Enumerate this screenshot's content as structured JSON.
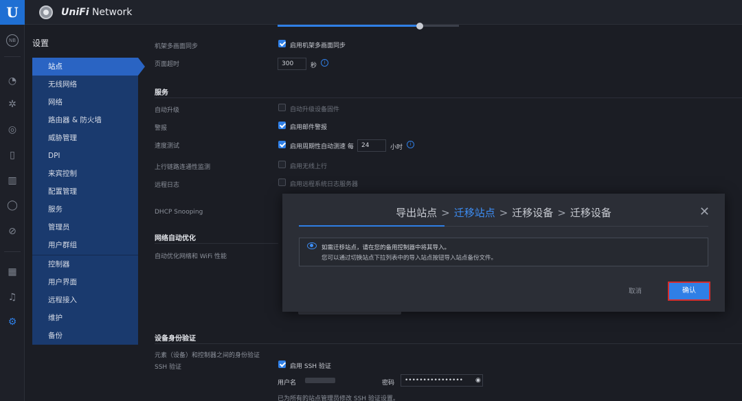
{
  "header": {
    "brand_prefix": "UniFi",
    "brand_suffix": " Network",
    "logo_letter": "U"
  },
  "rail": {
    "avatar": "NB"
  },
  "settings": {
    "title": "设置",
    "nav": [
      {
        "label": "站点",
        "active": true
      },
      {
        "label": "无线网络"
      },
      {
        "label": "网络"
      },
      {
        "label": "路由器 & 防火墙"
      },
      {
        "label": "威胁管理"
      },
      {
        "label": "DPI"
      },
      {
        "label": "来宾控制"
      },
      {
        "label": "配置管理"
      },
      {
        "label": "服务"
      },
      {
        "label": "管理员"
      },
      {
        "label": "用户群组"
      },
      {
        "label": "控制器"
      },
      {
        "label": "用户界面"
      },
      {
        "label": "远程接入"
      },
      {
        "label": "维护"
      },
      {
        "label": "备份"
      }
    ]
  },
  "content": {
    "row_multi_sync_label": "机架多画面同步",
    "row_multi_sync_cb": "启用机架多画面同步",
    "row_timeout_label": "页面超时",
    "row_timeout_value": "300",
    "row_timeout_unit": "秒",
    "services_title": "服务",
    "auto_upgrade_label": "自动升级",
    "auto_upgrade_cb": "自动升级设备固件",
    "alert_label": "警报",
    "alert_cb": "启用邮件警报",
    "speed_label": "速度测试",
    "speed_cb": "启用周期性自动测速 每",
    "speed_value": "24",
    "speed_unit": "小时",
    "uplink_label": "上行链路连通性监测",
    "uplink_cb": "启用无线上行",
    "syslog_label": "远程日志",
    "syslog_cb": "启用远程系统日志服务器",
    "dhcp_label": "DHCP Snooping",
    "net_opt_title": "网络自动优化",
    "net_opt_label": "自动优化网络和 WiFi 性能",
    "device_auth_title": "设备身份验证",
    "device_auth_desc": "元素（设备）和控制器之间的身份验证",
    "ssh_label": "SSH 验证",
    "ssh_cb": "启用 SSH 验证",
    "username_label": "用户名",
    "password_label": "密码",
    "password_value": "••••••••••••••••",
    "ssh_note": "已为所有的站点管理员修改 SSH 验证设置。"
  },
  "modal": {
    "steps": [
      "导出站点",
      "迁移站点",
      "迁移设备",
      "迁移设备"
    ],
    "active_step": 1,
    "notice_line1": "如需迁移站点，请在您的备用控制器中将其导入。",
    "notice_line2": "您可以通过切换站点下拉列表中的导入站点按钮导入站点备份文件。",
    "cancel": "取消",
    "confirm": "确认"
  },
  "colors": {
    "accent": "#2f7fe6",
    "nav_bg": "#1a3a6e",
    "highlight_border": "#d72d2d"
  }
}
